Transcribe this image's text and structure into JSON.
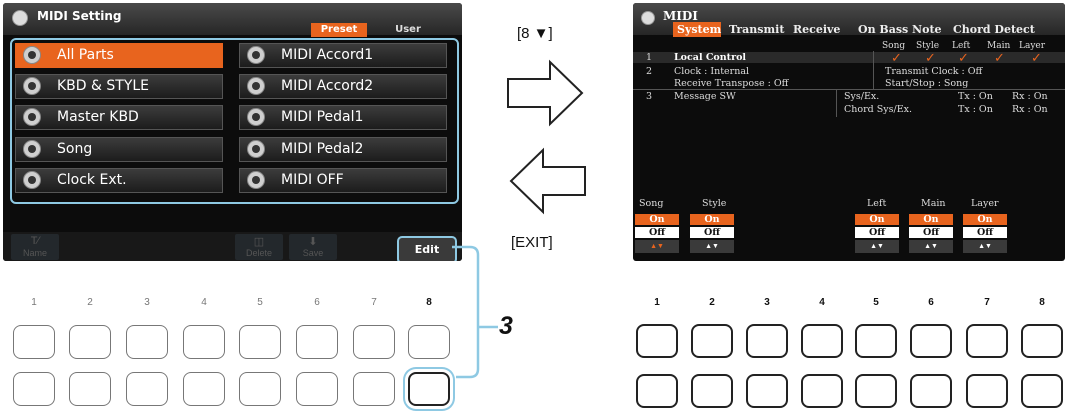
{
  "left_screen": {
    "title": "MIDI Setting",
    "tabs": [
      "Preset",
      "User"
    ],
    "active_tab": "Preset",
    "presets_left": [
      "All Parts",
      "KBD & STYLE",
      "Master KBD",
      "Song",
      "Clock Ext."
    ],
    "presets_right": [
      "MIDI Accord1",
      "MIDI Accord2",
      "MIDI Pedal1",
      "MIDI Pedal2",
      "MIDI OFF"
    ],
    "selected_preset": "All Parts",
    "bottom_buttons": [
      {
        "icon": "T",
        "label": "Name"
      },
      {
        "icon": "trash-icon",
        "label": "Delete"
      },
      {
        "icon": "save-icon",
        "label": "Save"
      }
    ],
    "edit_label": "Edit"
  },
  "middle": {
    "top_hint": "[8 ▼]",
    "bottom_hint": "[EXIT]",
    "step_number": "3"
  },
  "button_numbers": [
    "1",
    "2",
    "3",
    "4",
    "5",
    "6",
    "7",
    "8"
  ],
  "right_screen": {
    "title": "MIDI",
    "tabs": [
      "System",
      "Transmit",
      "Receive",
      "On Bass Note",
      "Chord Detect"
    ],
    "active_tab": "System",
    "column_headers": [
      "Song",
      "Style",
      "Left",
      "Main",
      "Layer"
    ],
    "rows": [
      {
        "num": "1",
        "label": "Local Control"
      },
      {
        "num": "2",
        "label": "Clock : Internal",
        "extra": "Transmit Clock : Off"
      },
      {
        "num": "",
        "label": "Receive Transpose : Off",
        "extra": "Start/Stop : Song"
      },
      {
        "num": "3",
        "label": "Message SW",
        "extra": "Sys/Ex.",
        "tx": "Tx : On",
        "rx": "Rx : On"
      },
      {
        "num": "",
        "label": "",
        "extra": "Chord Sys/Ex.",
        "tx": "Tx : On",
        "rx": "Rx : On"
      }
    ],
    "bottom_params": [
      "Song",
      "Style",
      "Left",
      "Main",
      "Layer"
    ],
    "on_label": "On",
    "off_label": "Off",
    "arrows_label": "▲▼"
  },
  "colors": {
    "accent": "#e8641e",
    "highlight": "#8ec9e3"
  }
}
